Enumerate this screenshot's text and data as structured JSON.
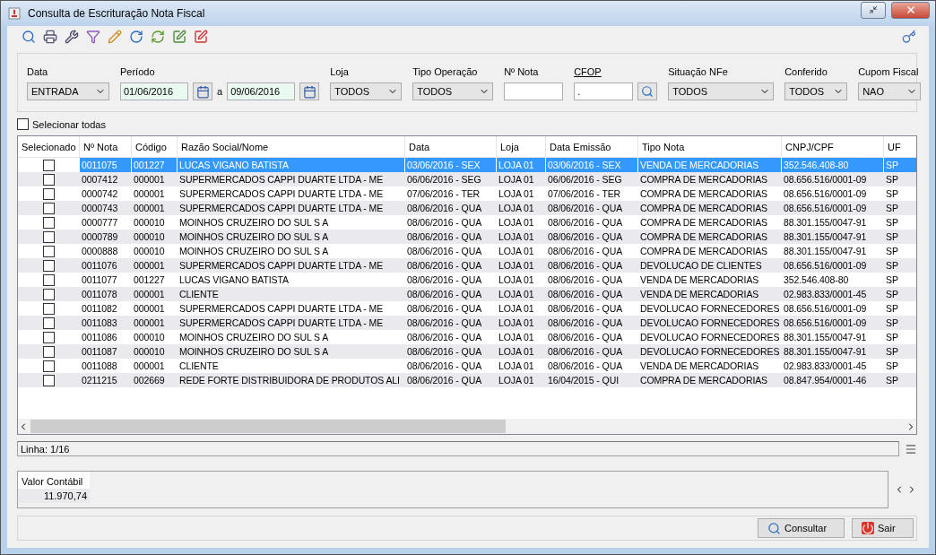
{
  "window": {
    "title": "Consulta de Escrituração Nota Fiscal"
  },
  "filters": [
    {
      "kind": "select",
      "label": "Data",
      "value": "ENTRADA"
    },
    {
      "kind": "period",
      "label": "Período",
      "from": "01/06/2016",
      "separator": "a",
      "to": "09/06/2016"
    },
    {
      "kind": "select",
      "label": "Loja",
      "value": "TODOS"
    },
    {
      "kind": "select",
      "label": "Tipo Operação",
      "value": "TODOS"
    },
    {
      "kind": "text",
      "label": "Nº Nota"
    },
    {
      "kind": "lookup",
      "label": "CFOP",
      "value": "."
    },
    {
      "kind": "select",
      "label": "Situação NFe",
      "value": "TODOS"
    },
    {
      "kind": "select",
      "label": "Conferido",
      "value": "TODOS"
    },
    {
      "kind": "select",
      "label": "Cupom Fiscal",
      "value": "NAO"
    }
  ],
  "select_all": {
    "label": "Selecionar todas",
    "checked": false
  },
  "table": {
    "checkbox_column": "Selecionado",
    "columns": [
      "Nº Nota",
      "Código",
      "Razão Social/Nome",
      "Data",
      "Loja",
      "Data Emissão",
      "Tipo Nota",
      "CNPJ/CPF",
      "UF"
    ],
    "rows": [
      {
        "selected": true,
        "checked": false,
        "cells": [
          "0011075",
          "001227",
          "LUCAS VIGANO BATISTA",
          "03/06/2016 - SEX",
          "LOJA 01",
          "03/06/2016 - SEX",
          "VENDA DE MERCADORIAS",
          "352.546.408-80",
          "SP"
        ]
      },
      {
        "selected": false,
        "checked": false,
        "cells": [
          "0007412",
          "000001",
          "SUPERMERCADOS CAPPI DUARTE LTDA - ME",
          "06/06/2016 - SEG",
          "LOJA 01",
          "06/06/2016 - SEG",
          "COMPRA DE MERCADORIAS",
          "08.656.516/0001-09",
          "SP"
        ]
      },
      {
        "selected": false,
        "checked": false,
        "cells": [
          "0000742",
          "000001",
          "SUPERMERCADOS CAPPI DUARTE LTDA - ME",
          "07/06/2016 - TER",
          "LOJA 01",
          "07/06/2016 - TER",
          "COMPRA DE MERCADORIAS",
          "08.656.516/0001-09",
          "SP"
        ]
      },
      {
        "selected": false,
        "checked": false,
        "cells": [
          "0000743",
          "000001",
          "SUPERMERCADOS CAPPI DUARTE LTDA - ME",
          "08/06/2016 - QUA",
          "LOJA 01",
          "08/06/2016 - QUA",
          "COMPRA DE MERCADORIAS",
          "08.656.516/0001-09",
          "SP"
        ]
      },
      {
        "selected": false,
        "checked": false,
        "cells": [
          "0000777",
          "000010",
          "MOINHOS CRUZEIRO DO SUL S A",
          "08/06/2016 - QUA",
          "LOJA 01",
          "08/06/2016 - QUA",
          "COMPRA DE MERCADORIAS",
          "88.301.155/0047-91",
          "SP"
        ]
      },
      {
        "selected": false,
        "checked": false,
        "cells": [
          "0000789",
          "000010",
          "MOINHOS CRUZEIRO DO SUL S A",
          "08/06/2016 - QUA",
          "LOJA 01",
          "08/06/2016 - QUA",
          "COMPRA DE MERCADORIAS",
          "88.301.155/0047-91",
          "SP"
        ]
      },
      {
        "selected": false,
        "checked": false,
        "cells": [
          "0000888",
          "000010",
          "MOINHOS CRUZEIRO DO SUL S A",
          "08/06/2016 - QUA",
          "LOJA 01",
          "08/06/2016 - QUA",
          "COMPRA DE MERCADORIAS",
          "88.301.155/0047-91",
          "SP"
        ]
      },
      {
        "selected": false,
        "checked": false,
        "cells": [
          "0011076",
          "000001",
          "SUPERMERCADOS CAPPI DUARTE LTDA - ME",
          "08/06/2016 - QUA",
          "LOJA 01",
          "08/06/2016 - QUA",
          "DEVOLUCAO DE CLIENTES",
          "08.656.516/0001-09",
          "SP"
        ]
      },
      {
        "selected": false,
        "checked": false,
        "cells": [
          "0011077",
          "001227",
          "LUCAS VIGANO BATISTA",
          "08/06/2016 - QUA",
          "LOJA 01",
          "08/06/2016 - QUA",
          "VENDA DE MERCADORIAS",
          "352.546.408-80",
          "SP"
        ]
      },
      {
        "selected": false,
        "checked": false,
        "cells": [
          "0011078",
          "000001",
          "CLIENTE",
          "08/06/2016 - QUA",
          "LOJA 01",
          "08/06/2016 - QUA",
          "VENDA DE MERCADORIAS",
          "02.983.833/0001-45",
          "SP"
        ]
      },
      {
        "selected": false,
        "checked": false,
        "cells": [
          "0011082",
          "000001",
          "SUPERMERCADOS CAPPI DUARTE LTDA - ME",
          "08/06/2016 - QUA",
          "LOJA 01",
          "08/06/2016 - QUA",
          "DEVOLUCAO FORNECEDORES",
          "08.656.516/0001-09",
          "SP"
        ]
      },
      {
        "selected": false,
        "checked": false,
        "cells": [
          "0011083",
          "000001",
          "SUPERMERCADOS CAPPI DUARTE LTDA - ME",
          "08/06/2016 - QUA",
          "LOJA 01",
          "08/06/2016 - QUA",
          "DEVOLUCAO FORNECEDORES",
          "08.656.516/0001-09",
          "SP"
        ]
      },
      {
        "selected": false,
        "checked": false,
        "cells": [
          "0011086",
          "000010",
          "MOINHOS CRUZEIRO DO SUL S A",
          "08/06/2016 - QUA",
          "LOJA 01",
          "08/06/2016 - QUA",
          "DEVOLUCAO FORNECEDORES",
          "88.301.155/0047-91",
          "SP"
        ]
      },
      {
        "selected": false,
        "checked": false,
        "cells": [
          "0011087",
          "000010",
          "MOINHOS CRUZEIRO DO SUL S A",
          "08/06/2016 - QUA",
          "LOJA 01",
          "08/06/2016 - QUA",
          "DEVOLUCAO FORNECEDORES",
          "88.301.155/0047-91",
          "SP"
        ]
      },
      {
        "selected": false,
        "checked": false,
        "cells": [
          "0011088",
          "000001",
          "CLIENTE",
          "08/06/2016 - QUA",
          "LOJA 01",
          "08/06/2016 - QUA",
          "VENDA DE MERCADORIAS",
          "02.983.833/0001-45",
          "SP"
        ]
      },
      {
        "selected": false,
        "checked": false,
        "cells": [
          "0211215",
          "002669",
          "REDE FORTE DISTRIBUIDORA DE PRODUTOS ALI",
          "08/06/2016 - QUA",
          "LOJA 01",
          "16/04/2015 - QUI",
          "COMPRA DE MERCADORIAS",
          "08.847.954/0001-46",
          "SP"
        ]
      }
    ]
  },
  "status": {
    "text": "Linha: 1/16"
  },
  "totals": [
    {
      "label": "Valor Contábil",
      "value": "11.970,74"
    }
  ],
  "buttons": [
    {
      "kind": "search",
      "label": "Consultar"
    },
    {
      "kind": "exit",
      "label": "Sair"
    }
  ]
}
